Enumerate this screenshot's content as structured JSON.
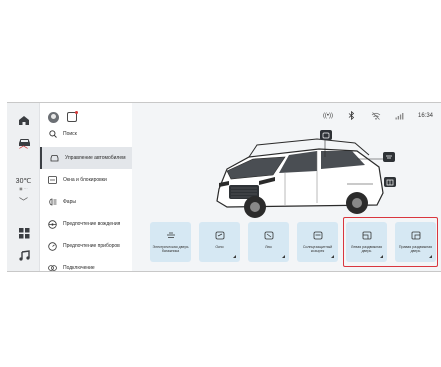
{
  "status_bar": {
    "time": "16:34",
    "icons": [
      "wireless-icon",
      "bluetooth-icon",
      "wifi-off-icon",
      "signal-icon"
    ]
  },
  "climate": {
    "temperature": "30℃",
    "sub": "◼ ···"
  },
  "dock": {
    "icons": [
      "home-icon",
      "car-icon",
      "apps-icon",
      "music-icon"
    ]
  },
  "menu": {
    "items": [
      {
        "label": "Поиск",
        "icon": "search-icon"
      },
      {
        "label": "Управление автомобилем",
        "icon": "car-control-icon",
        "active": true
      },
      {
        "label": "Окна и блокировки",
        "icon": "window-lock-icon"
      },
      {
        "label": "Фары",
        "icon": "headlight-icon"
      },
      {
        "label": "Предпочтение вождения",
        "icon": "steering-icon"
      },
      {
        "label": "Предпочтение приборов",
        "icon": "gauge-icon"
      },
      {
        "label": "Подключение",
        "icon": "connection-icon"
      }
    ]
  },
  "controls": [
    {
      "label": "Электрическая дверь багажника",
      "icon": "tailgate-icon"
    },
    {
      "label": "Окно",
      "icon": "window-icon"
    },
    {
      "label": "Люк",
      "icon": "sunroof-icon"
    },
    {
      "label": "Солнцезащитный козырек",
      "icon": "sunshade-icon"
    },
    {
      "label": "Левая раздвижная дверь",
      "icon": "left-door-icon"
    },
    {
      "label": "Правая раздвижная дверь",
      "icon": "right-door-icon"
    }
  ],
  "colors": {
    "accent_highlight": "#d9363e",
    "tile_bg": "#d6e8f3",
    "climate_accent": "#cc2c2c"
  }
}
